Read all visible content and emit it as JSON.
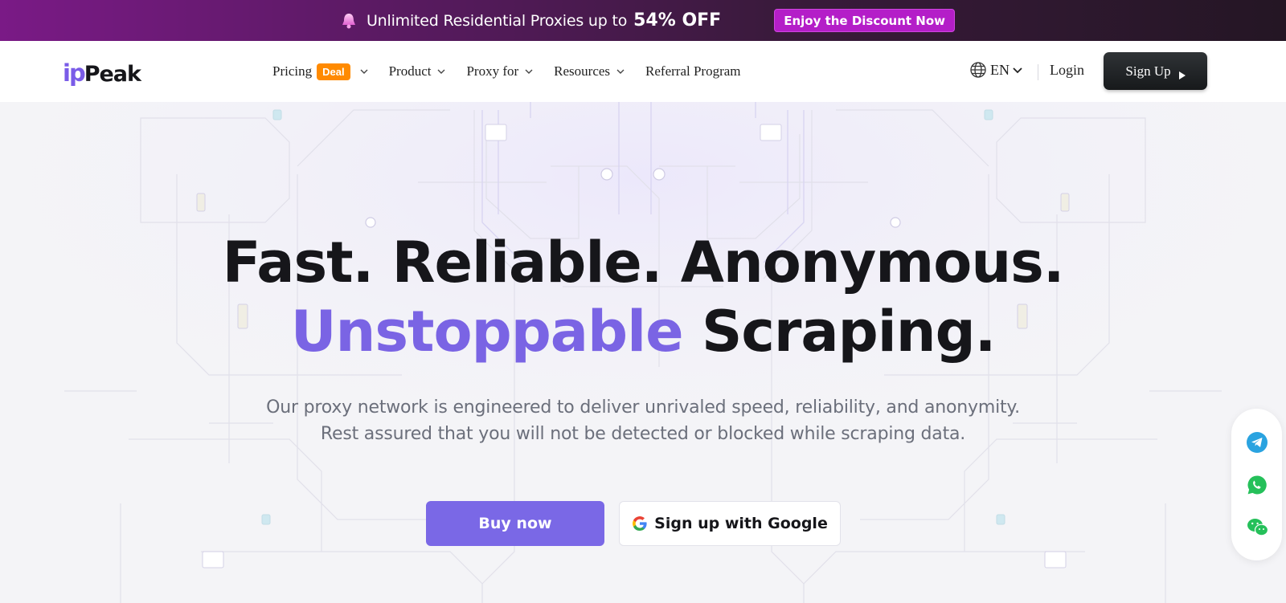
{
  "promo": {
    "text": "Unlimited Residential Proxies up to",
    "discount": "54% OFF",
    "cta": "Enjoy the Discount Now"
  },
  "nav": {
    "logo_ip": "ip",
    "logo_peak": "Peak",
    "items": [
      {
        "label": "Pricing",
        "badge": "Deal"
      },
      {
        "label": "Product"
      },
      {
        "label": "Proxy for"
      },
      {
        "label": "Resources"
      },
      {
        "label": "Referral Program"
      }
    ],
    "language": "EN",
    "login": "Login",
    "signup": "Sign Up"
  },
  "hero": {
    "line1": "Fast. Reliable. Anonymous.",
    "line2_accent": "Unstoppable",
    "line2_rest": "Scraping.",
    "sub1": "Our proxy network is engineered to deliver unrivaled speed, reliability, and anonymity.",
    "sub2": "Rest assured that you will not be detected or blocked while scraping data.",
    "buy_label": "Buy now",
    "google_label": "Sign up with Google"
  },
  "contact_icons": [
    "telegram-icon",
    "whatsapp-icon",
    "wechat-icon"
  ],
  "colors": {
    "accent": "#7a64e4",
    "deal": "#ff8a00",
    "promo_cta": "#b41ec8"
  }
}
